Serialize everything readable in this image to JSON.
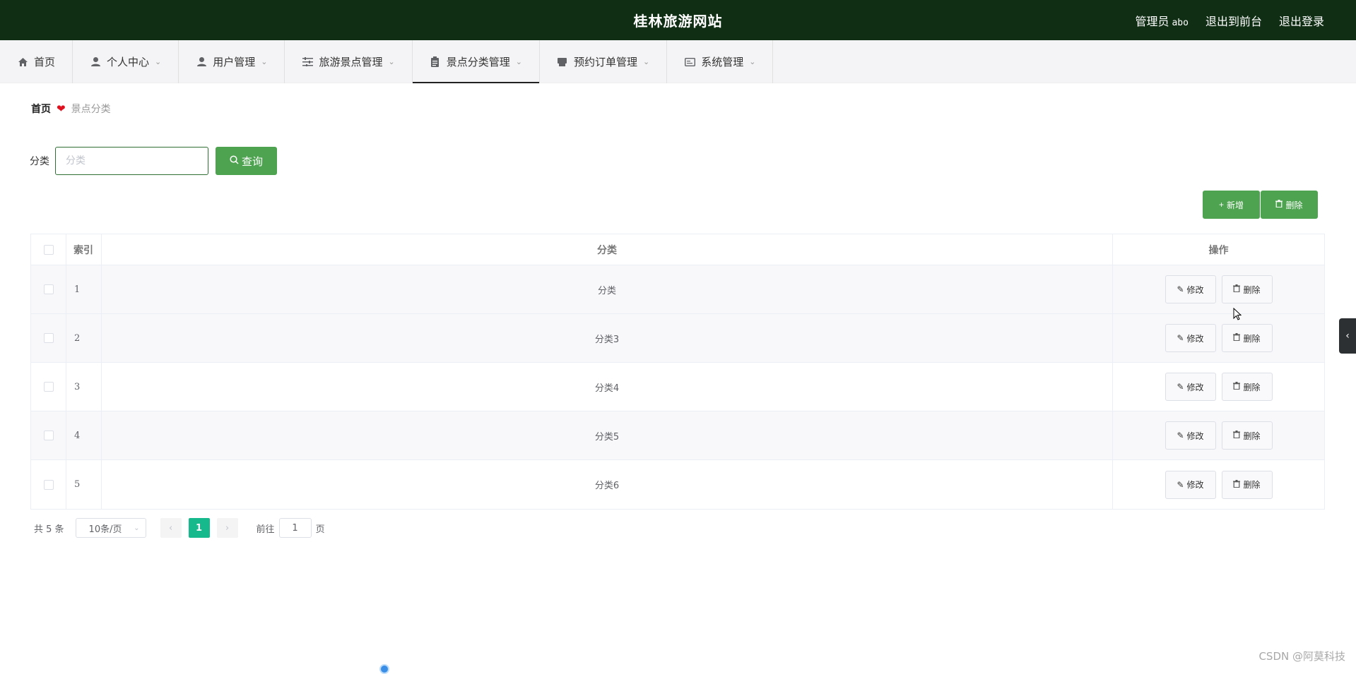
{
  "header": {
    "site_title": "桂林旅游网站",
    "user_role": "管理员",
    "user_name": "abo",
    "to_frontend": "退出到前台",
    "logout": "退出登录"
  },
  "nav": {
    "items": [
      {
        "label": "首页",
        "icon": "home-icon"
      },
      {
        "label": "个人中心",
        "icon": "user-icon"
      },
      {
        "label": "用户管理",
        "icon": "user-manage-icon"
      },
      {
        "label": "旅游景点管理",
        "icon": "sliders-icon"
      },
      {
        "label": "景点分类管理",
        "icon": "clipboard-icon"
      },
      {
        "label": "预约订单管理",
        "icon": "printer-icon"
      },
      {
        "label": "系统管理",
        "icon": "card-icon"
      }
    ],
    "active_index": 4
  },
  "breadcrumb": {
    "home": "首页",
    "current": "景点分类"
  },
  "search": {
    "label": "分类",
    "placeholder": "分类",
    "value": "",
    "button_label": "查询"
  },
  "actions": {
    "add_label": "新增",
    "delete_label": "删除"
  },
  "table": {
    "columns": [
      "索引",
      "分类",
      "操作"
    ],
    "rows": [
      {
        "index": "1",
        "category": "分类"
      },
      {
        "index": "2",
        "category": "分类3"
      },
      {
        "index": "3",
        "category": "分类4"
      },
      {
        "index": "4",
        "category": "分类5"
      },
      {
        "index": "5",
        "category": "分类6"
      }
    ],
    "edit_label": "修改",
    "delete_label": "删除"
  },
  "pagination": {
    "total_text": "共 5 条",
    "page_size": "10条/页",
    "current_page": "1",
    "goto_prefix": "前往",
    "goto_value": "1",
    "goto_suffix": "页"
  },
  "watermark": "CSDN @阿莫科技",
  "colors": {
    "topbar_bg": "#0f2e14",
    "primary_green": "#4ea350",
    "page_active": "#16b98b",
    "heart": "#e0101e"
  }
}
